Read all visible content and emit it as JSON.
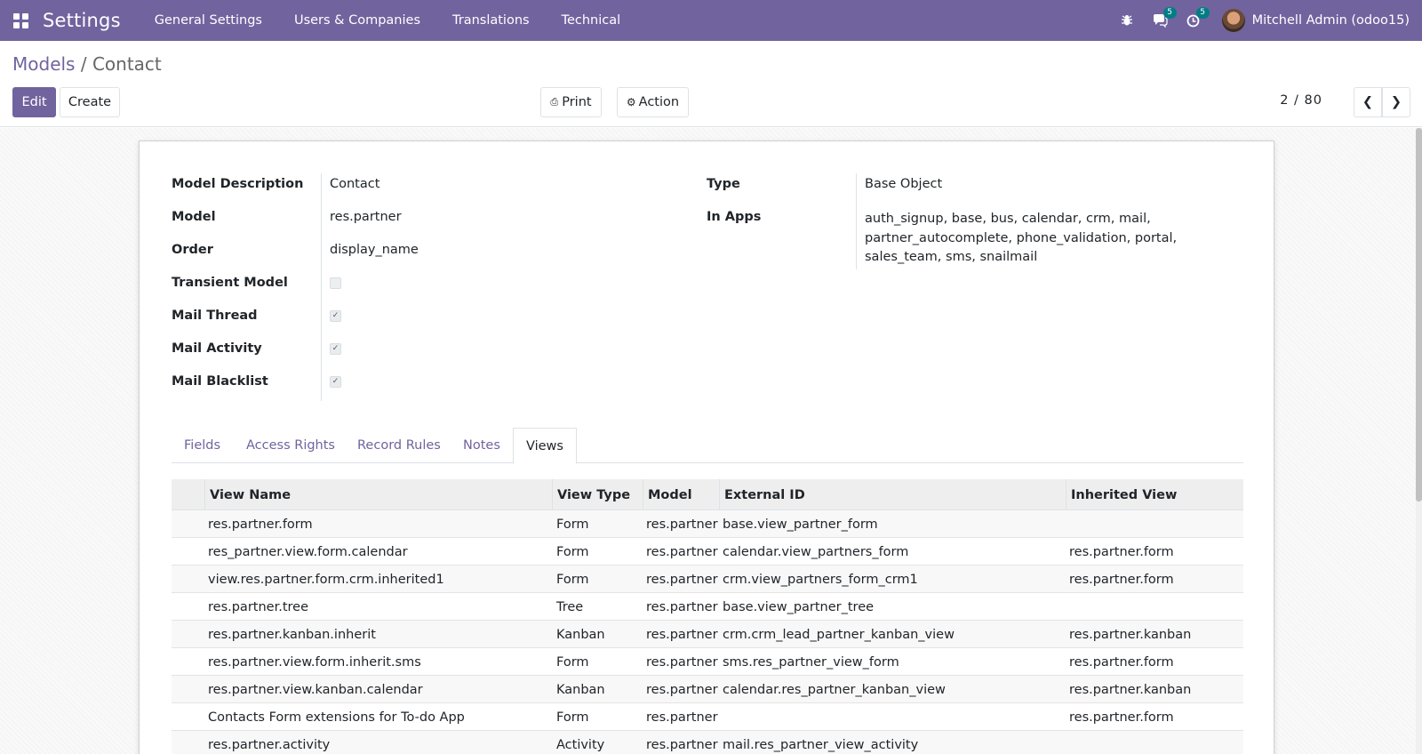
{
  "navbar": {
    "app_title": "Settings",
    "menu": [
      "General Settings",
      "Users & Companies",
      "Translations",
      "Technical"
    ],
    "bug_icon": "bug-icon",
    "messages_badge": "5",
    "activities_badge": "5",
    "user_name": "Mitchell Admin (odoo15)",
    "accent_color": "#71639e"
  },
  "breadcrumb": {
    "parent": "Models",
    "separator": "/",
    "current": "Contact"
  },
  "toolbar": {
    "edit": "Edit",
    "create": "Create",
    "print": "Print",
    "action": "Action"
  },
  "pager": {
    "value": "2 / 80"
  },
  "form": {
    "left": [
      {
        "label": "Model Description",
        "value": "Contact"
      },
      {
        "label": "Model",
        "value": "res.partner"
      },
      {
        "label": "Order",
        "value": "display_name"
      },
      {
        "label": "Transient Model",
        "checked": false
      },
      {
        "label": "Mail Thread",
        "checked": true
      },
      {
        "label": "Mail Activity",
        "checked": true
      },
      {
        "label": "Mail Blacklist",
        "checked": true
      }
    ],
    "right": {
      "type_label": "Type",
      "type_value": "Base Object",
      "apps_label": "In Apps",
      "apps_lines": [
        "auth_signup, base, bus, calendar, crm, mail,",
        "partner_autocomplete, phone_validation, portal,",
        "sales_team, sms, snailmail"
      ]
    }
  },
  "tabs": [
    "Fields",
    "Access Rights",
    "Record Rules",
    "Notes",
    "Views"
  ],
  "active_tab": "Views",
  "views_table": {
    "headers": [
      "View Name",
      "View Type",
      "Model",
      "External ID",
      "Inherited View"
    ],
    "rows": [
      [
        "res.partner.form",
        "Form",
        "res.partner",
        "base.view_partner_form",
        ""
      ],
      [
        "res_partner.view.form.calendar",
        "Form",
        "res.partner",
        "calendar.view_partners_form",
        "res.partner.form"
      ],
      [
        "view.res.partner.form.crm.inherited1",
        "Form",
        "res.partner",
        "crm.view_partners_form_crm1",
        "res.partner.form"
      ],
      [
        "res.partner.tree",
        "Tree",
        "res.partner",
        "base.view_partner_tree",
        ""
      ],
      [
        "res.partner.kanban.inherit",
        "Kanban",
        "res.partner",
        "crm.crm_lead_partner_kanban_view",
        "res.partner.kanban"
      ],
      [
        "res.partner.view.form.inherit.sms",
        "Form",
        "res.partner",
        "sms.res_partner_view_form",
        "res.partner.form"
      ],
      [
        "res.partner.view.kanban.calendar",
        "Kanban",
        "res.partner",
        "calendar.res_partner_kanban_view",
        "res.partner.kanban"
      ],
      [
        "Contacts Form extensions for To-do App",
        "Form",
        "res.partner",
        "",
        "res.partner.form"
      ],
      [
        "res.partner.activity",
        "Activity",
        "res.partner",
        "mail.res_partner_view_activity",
        ""
      ]
    ]
  }
}
